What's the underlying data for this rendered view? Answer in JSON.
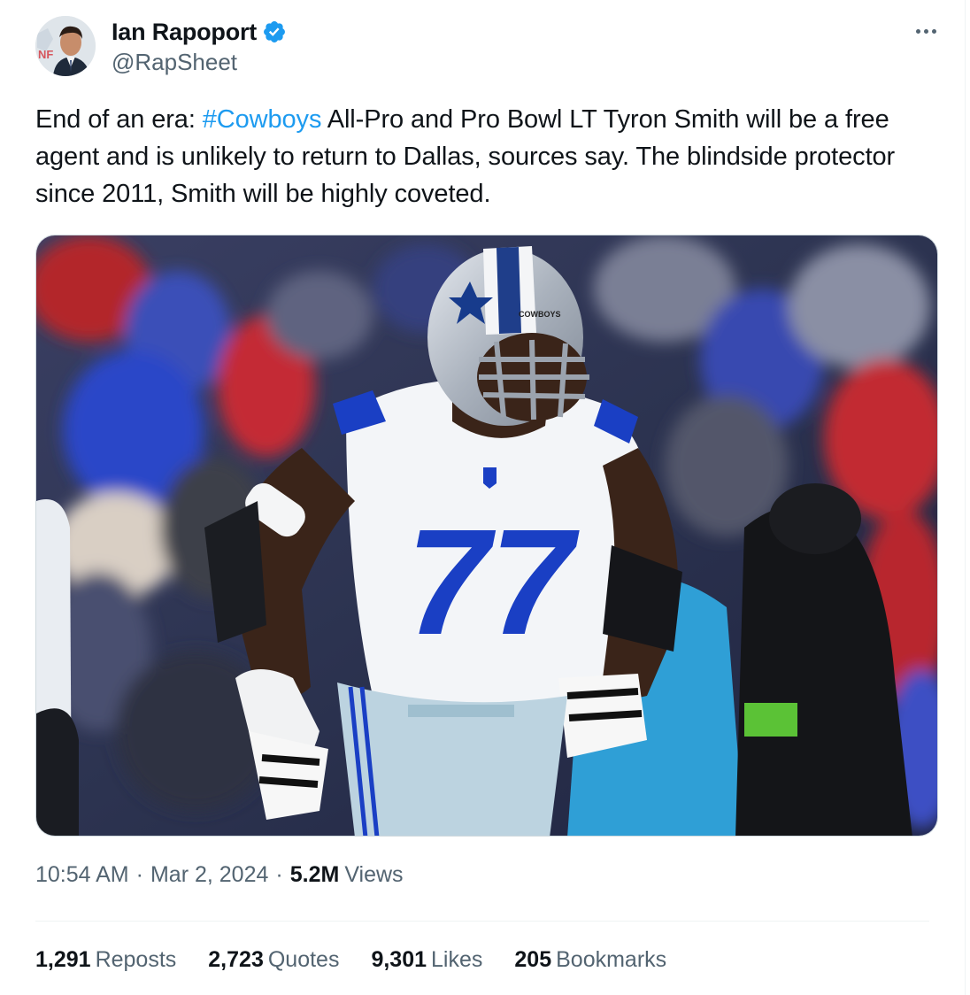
{
  "author": {
    "display_name": "Ian Rapoport",
    "handle": "@RapSheet",
    "verified": true,
    "avatar": "author-avatar"
  },
  "tweet": {
    "text_before": "End of an era: ",
    "hashtag": "#Cowboys",
    "text_after": " All-Pro and Pro Bowl LT Tyron Smith will be a free agent and is unlikely to return to Dallas, sources say. The blindside protector since 2011, Smith will be highly coveted.",
    "media": {
      "icon": "football-player-photo",
      "jersey_number": "77",
      "helmet_text": "COWBOYS"
    }
  },
  "meta": {
    "time": "10:54 AM",
    "separator": "·",
    "date": "Mar 2, 2024",
    "views_count": "5.2M",
    "views_label": "Views"
  },
  "stats": [
    {
      "count": "1,291",
      "label": "Reposts"
    },
    {
      "count": "2,723",
      "label": "Quotes"
    },
    {
      "count": "9,301",
      "label": "Likes"
    },
    {
      "count": "205",
      "label": "Bookmarks"
    }
  ],
  "colors": {
    "accent": "#1d9bf0",
    "text": "#0f1419",
    "secondary": "#536471",
    "jersey_blue": "#1a3fc4"
  }
}
